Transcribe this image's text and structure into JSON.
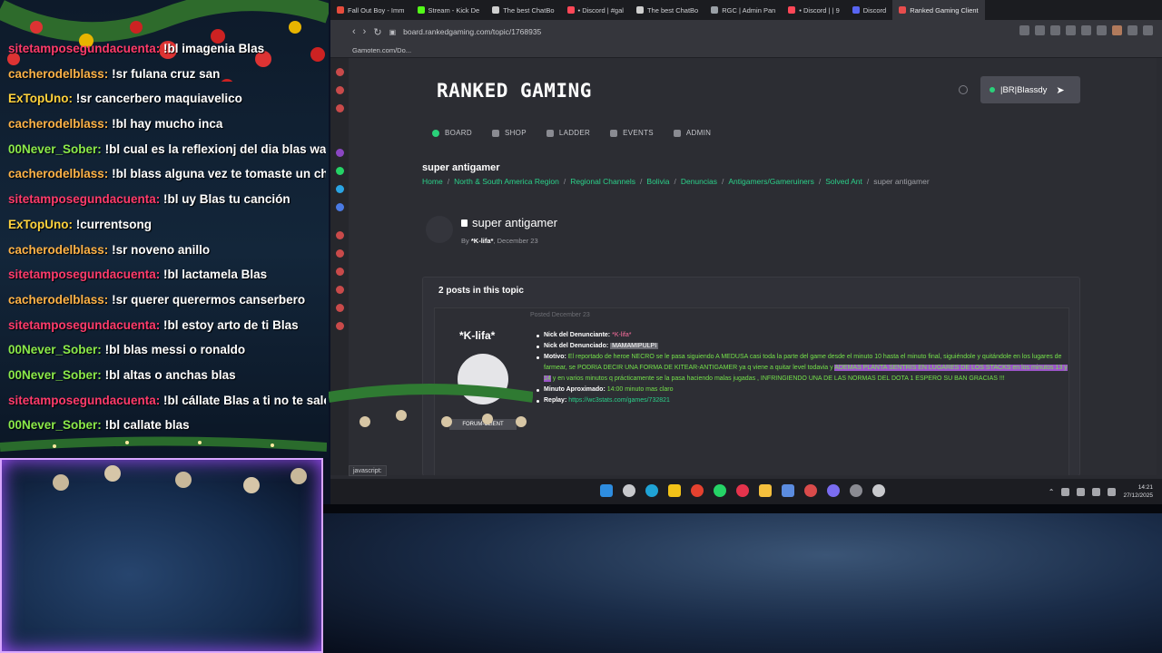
{
  "chat": {
    "lines": [
      {
        "user": "sitetamposegundacuenta:",
        "user_color": "#ff3b6b",
        "text": "!bl imagenia Blas"
      },
      {
        "user": "cacherodelblass:",
        "user_color": "#ffb347",
        "text": "!sr fulana cruz san"
      },
      {
        "user": "ExTopUno:",
        "user_color": "#ffd23c",
        "text": "!sr cancerbero maquiavelico"
      },
      {
        "user": "cacherodelblass:",
        "user_color": "#ffb347",
        "text": "!bl hay mucho inca"
      },
      {
        "user": "00Never_Sober:",
        "user_color": "#8bea4a",
        "text": "!bl cual es la reflexionj del dia blas wano"
      },
      {
        "user": "cacherodelblass:",
        "user_color": "#ffb347",
        "text": "!bl blass alguna vez te tomaste un chimbor"
      },
      {
        "user": "sitetamposegundacuenta:",
        "user_color": "#ff3b6b",
        "text": "!bl uy Blas tu canción"
      },
      {
        "user": "ExTopUno:",
        "user_color": "#ffd23c",
        "text": "!currentsong"
      },
      {
        "user": "cacherodelblass:",
        "user_color": "#ffb347",
        "text": "!sr noveno anillo"
      },
      {
        "user": "sitetamposegundacuenta:",
        "user_color": "#ff3b6b",
        "text": "!bl lactamela Blas"
      },
      {
        "user": "cacherodelblass:",
        "user_color": "#ffb347",
        "text": "!sr querer querermos canserbero"
      },
      {
        "user": "sitetamposegundacuenta:",
        "user_color": "#ff3b6b",
        "text": "!bl estoy arto de ti Blas"
      },
      {
        "user": "00Never_Sober:",
        "user_color": "#8bea4a",
        "text": "!bl blas messi o ronaldo"
      },
      {
        "user": "00Never_Sober:",
        "user_color": "#8bea4a",
        "text": "!bl altas o anchas blas"
      },
      {
        "user": "sitetamposegundacuenta:",
        "user_color": "#ff3b6b",
        "text": "!bl cállate Blas a ti no te sale"
      },
      {
        "user": "00Never_Sober:",
        "user_color": "#8bea4a",
        "text": "!bl callate blas"
      }
    ]
  },
  "browser": {
    "tabs": [
      {
        "label": "Fall Out Boy - Imm",
        "color": "#e74c3c"
      },
      {
        "label": "Stream - Kick De",
        "color": "#53fc18"
      },
      {
        "label": "The best ChatBo",
        "color": "#cfcfcf"
      },
      {
        "label": "• Discord | #gal",
        "color": "#ff4757"
      },
      {
        "label": "The best ChatBo",
        "color": "#cfcfcf"
      },
      {
        "label": "RGC | Admin Pan",
        "color": "#9aa0a6"
      },
      {
        "label": "• Discord | | 9",
        "color": "#ff4757"
      },
      {
        "label": "Discord",
        "color": "#5865f2"
      },
      {
        "label": "Ranked Gaming Client",
        "color": "#e84d4d",
        "active": true
      }
    ],
    "url": "board.rankedgaming.com/topic/1768935",
    "bookmark": "Gamoten.com/Do...",
    "status_url": "javascript:"
  },
  "site": {
    "logo": "RANKED GAMING",
    "user": "|BR|Blassdy",
    "nav": [
      {
        "label": "BOARD",
        "active": true
      },
      {
        "label": "SHOP"
      },
      {
        "label": "LADDER"
      },
      {
        "label": "EVENTS"
      },
      {
        "label": "ADMIN"
      }
    ]
  },
  "topic": {
    "header": "super antigamer",
    "breadcrumb": [
      "Home",
      "North & South America Region",
      "Regional Channels",
      "Bolivia",
      "Denuncias",
      "Antigamers/Gameruiners",
      "Solved Ant",
      "super antigamer"
    ],
    "title": "super antigamer",
    "by_label": "By",
    "author": "*K-lifa*",
    "date": "December 23",
    "posts_count": "2 posts in this topic"
  },
  "post": {
    "author": "*K-lifa*",
    "role": "FORUM-CLIENT",
    "posted": "Posted December 23",
    "fields": {
      "denunciante_label": "Nick del Denunciante:",
      "denunciante_value": "*K-lifa*",
      "denunciado_label": "Nick del Denunciado:",
      "denunciado_value": "MAMAMIPULPI",
      "motivo_label": "Motivo:",
      "motivo_1": "El reportado de heroe NECRO se le pasa siguiendo A MEDUSA casi toda la parte del game desde el minuto 10 hasta el minuto final, siguiéndole y quitándole en los lugares de farmear, se PODRIA DECIR UNA FORMA DE KITEAR-ANTIGAMER ya q viene a quitar level todavia y",
      "motivo_hl": "ADEMAS PLANTA SENTRIS EN LUGARES DE LOS STACKS en los minutos 13 y 14",
      "motivo_2": "y en varios minutos q prácticamente se la pasa haciendo malas jugadas , INFRINGIENDO UNA DE LAS NORMAS DEL DOTA 1 ESPERO SU BAN GRACIAS !!!",
      "minuto_label": "Minuto Aproximado:",
      "minuto_value": "14:00 minuto mas claro",
      "replay_label": "Replay:",
      "replay_value": "https://wc3stats.com/games/732821"
    }
  },
  "taskbar": {
    "time": "14:21",
    "date": "27/12/2025"
  },
  "colors": {
    "accent_green": "#2bd18a",
    "pink": "#ff6fa0",
    "highlight": "#9c55c9"
  }
}
